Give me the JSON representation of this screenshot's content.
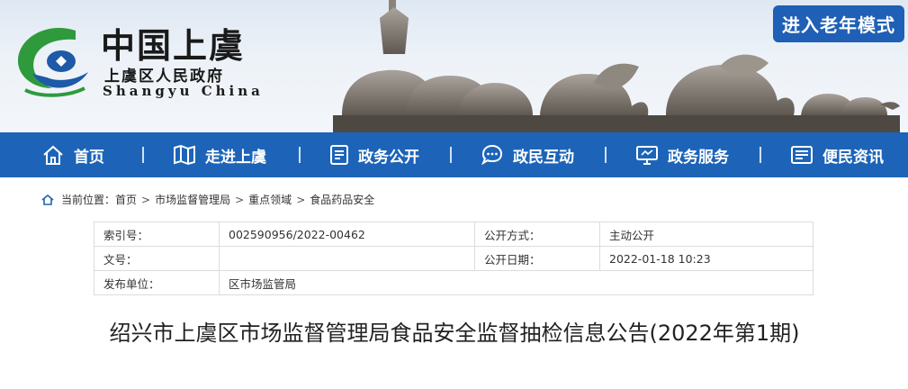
{
  "header": {
    "title": "中国上虞",
    "subtitle_cn": "上虞区人民政府",
    "subtitle_en": "Shangyu China",
    "elder_mode_label": "进入老年模式",
    "logo_icon": "shangyu-logo-icon",
    "banner_image": "elephant-sculpture-image"
  },
  "nav": {
    "items": [
      {
        "label": "首页",
        "icon": "home-icon"
      },
      {
        "label": "走进上虞",
        "icon": "map-icon"
      },
      {
        "label": "政务公开",
        "icon": "document-icon"
      },
      {
        "label": "政民互动",
        "icon": "chat-icon"
      },
      {
        "label": "政务服务",
        "icon": "monitor-icon"
      },
      {
        "label": "便民资讯",
        "icon": "news-icon"
      }
    ]
  },
  "breadcrumb": {
    "prefix": "当前位置：",
    "items": [
      "首页",
      "市场监督管理局",
      "重点领域",
      "食品药品安全"
    ],
    "separator": ">"
  },
  "info_table": {
    "index_label": "索引号：",
    "index_value": "002590956/2022-00462",
    "open_method_label": "公开方式：",
    "open_method_value": "主动公开",
    "doc_no_label": "文号：",
    "doc_no_value": "",
    "open_date_label": "公开日期：",
    "open_date_value": "2022-01-18 10:23",
    "issuer_label": "发布单位：",
    "issuer_value": "区市场监管局"
  },
  "document": {
    "title": "绍兴市上虞区市场监督管理局食品安全监督抽检信息公告(2022年第1期)"
  },
  "colors": {
    "nav_bg": "#1d64b8",
    "elder_btn_bg": "#1f5fb5",
    "logo_green": "#2e9a3c",
    "logo_blue": "#1d5aa8"
  }
}
